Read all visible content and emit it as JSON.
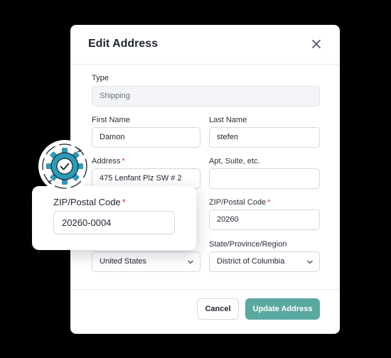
{
  "modal": {
    "title": "Edit Address",
    "close_icon": "close-icon"
  },
  "form": {
    "type": {
      "label": "Type",
      "value": "Shipping"
    },
    "first_name": {
      "label": "First Name",
      "value": "Damon"
    },
    "last_name": {
      "label": "Last Name",
      "value": "stefen"
    },
    "address": {
      "label": "Address",
      "required_mark": "*",
      "value": "475 Lenfant Plz SW # 2"
    },
    "apt": {
      "label": "Apt, Suite, etc.",
      "value": ""
    },
    "zip": {
      "label": "ZIP/Postal Code",
      "required_mark": "*",
      "value": "20260"
    },
    "country": {
      "value": "United States"
    },
    "state": {
      "label": "State/Province/Region",
      "value": "District of Columbia"
    }
  },
  "buttons": {
    "cancel": "Cancel",
    "update": "Update Address"
  },
  "callout": {
    "label": "ZIP/Postal Code",
    "required_mark": "*",
    "value": "20260-0004",
    "icon": "gear-check-icon"
  },
  "colors": {
    "accent": "#5aa9a0",
    "gear": "#2a9bb8",
    "required": "#d23b3b"
  }
}
